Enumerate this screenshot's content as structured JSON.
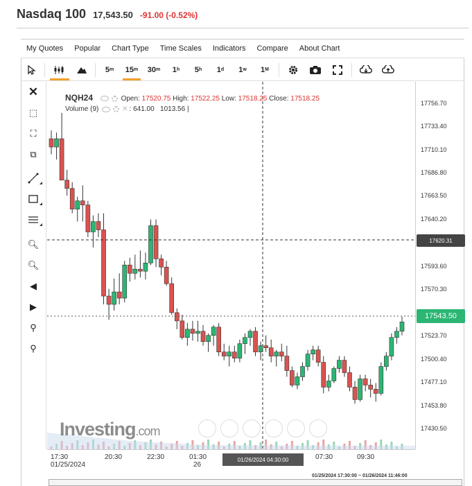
{
  "header": {
    "name": "Nasdaq 100",
    "price": "17,543.50",
    "change": "-91.00 (-0.52%)"
  },
  "menu": [
    "My Quotes",
    "Popular",
    "Chart Type",
    "Time Scales",
    "Indicators",
    "Compare",
    "About Chart"
  ],
  "timeframes": [
    {
      "n": "5",
      "u": "m"
    },
    {
      "n": "15",
      "u": "m"
    },
    {
      "n": "30",
      "u": "m"
    },
    {
      "n": "1",
      "u": "h"
    },
    {
      "n": "5",
      "u": "h"
    },
    {
      "n": "1",
      "u": "d"
    },
    {
      "n": "1",
      "u": "w"
    },
    {
      "n": "1",
      "u": "M"
    }
  ],
  "active_timeframe": "15m",
  "legend": {
    "symbol": "NQH24",
    "open_label": "Open:",
    "open": "17520.75",
    "high_label": "High:",
    "high": "17522.25",
    "low_label": "Low:",
    "low": "17518.25",
    "close_label": "Close:",
    "close": "17518.25",
    "volume_label": "Volume (9)",
    "vol1": "641.00",
    "vol2": "1013.56",
    "vol_suffix": "|"
  },
  "price_ticks": [
    "17756.70",
    "17733.40",
    "17710.10",
    "17686.80",
    "17663.50",
    "17640.20",
    "17593.60",
    "17570.30",
    "17523.70",
    "17500.40",
    "17477.10",
    "17453.80",
    "17430.50"
  ],
  "crosshair_price": "17620.31",
  "last_price": "17543.50",
  "time_ticks": [
    {
      "label": "17:30",
      "sub": "01/25/2024"
    },
    {
      "label": "20:30",
      "sub": ""
    },
    {
      "label": "22:30",
      "sub": ""
    },
    {
      "label": "01:30",
      "sub": "26"
    },
    {
      "label": "07:30",
      "sub": ""
    },
    {
      "label": "09:30",
      "sub": ""
    }
  ],
  "crosshair_time": "01/26/2024 04:30:00",
  "range_label": "01/25/2024 17:30:00 ~ 01/26/2024 11:46:00",
  "watermark": {
    "main": "Investing",
    "suffix": ".com"
  },
  "colors": {
    "up": "#2bb673",
    "down": "#d9534f",
    "accent": "#f0a030"
  },
  "chart_data": {
    "type": "candlestick",
    "symbol": "NQH24",
    "ylim": [
      17420,
      17775
    ],
    "candles": [
      [
        17720,
        17728,
        17705,
        17712
      ],
      [
        17712,
        17726,
        17700,
        17720
      ],
      [
        17720,
        17745,
        17680,
        17680
      ],
      [
        17680,
        17690,
        17665,
        17672
      ],
      [
        17672,
        17678,
        17648,
        17652
      ],
      [
        17652,
        17664,
        17640,
        17660
      ],
      [
        17660,
        17675,
        17640,
        17656
      ],
      [
        17656,
        17660,
        17625,
        17630
      ],
      [
        17630,
        17646,
        17615,
        17640
      ],
      [
        17640,
        17648,
        17625,
        17632
      ],
      [
        17632,
        17648,
        17560,
        17568
      ],
      [
        17568,
        17575,
        17545,
        17560
      ],
      [
        17560,
        17585,
        17554,
        17572
      ],
      [
        17572,
        17590,
        17560,
        17566
      ],
      [
        17566,
        17602,
        17562,
        17598
      ],
      [
        17598,
        17605,
        17582,
        17590
      ],
      [
        17590,
        17608,
        17584,
        17594
      ],
      [
        17594,
        17612,
        17586,
        17592
      ],
      [
        17592,
        17610,
        17584,
        17600
      ],
      [
        17600,
        17642,
        17598,
        17636
      ],
      [
        17636,
        17642,
        17596,
        17604
      ],
      [
        17604,
        17608,
        17588,
        17596
      ],
      [
        17596,
        17602,
        17578,
        17580
      ],
      [
        17580,
        17586,
        17550,
        17552
      ],
      [
        17552,
        17556,
        17536,
        17544
      ],
      [
        17544,
        17550,
        17526,
        17528
      ],
      [
        17528,
        17542,
        17520,
        17536
      ],
      [
        17536,
        17544,
        17525,
        17532
      ],
      [
        17532,
        17544,
        17524,
        17534
      ],
      [
        17534,
        17540,
        17520,
        17524
      ],
      [
        17524,
        17532,
        17514,
        17530
      ],
      [
        17530,
        17540,
        17520,
        17538
      ],
      [
        17538,
        17542,
        17510,
        17514
      ],
      [
        17514,
        17522,
        17506,
        17510
      ],
      [
        17510,
        17520,
        17500,
        17514
      ],
      [
        17514,
        17520,
        17504,
        17508
      ],
      [
        17508,
        17526,
        17504,
        17522
      ],
      [
        17522,
        17532,
        17512,
        17528
      ],
      [
        17528,
        17536,
        17520,
        17534
      ],
      [
        17534,
        17538,
        17510,
        17514
      ],
      [
        17514,
        17524,
        17506,
        17520
      ],
      [
        17520,
        17530,
        17514,
        17518
      ],
      [
        17518,
        17526,
        17504,
        17510
      ],
      [
        17510,
        17516,
        17500,
        17514
      ],
      [
        17514,
        17522,
        17505,
        17510
      ],
      [
        17510,
        17520,
        17490,
        17496
      ],
      [
        17496,
        17500,
        17480,
        17482
      ],
      [
        17482,
        17494,
        17478,
        17490
      ],
      [
        17490,
        17504,
        17486,
        17500
      ],
      [
        17500,
        17516,
        17496,
        17512
      ],
      [
        17512,
        17520,
        17506,
        17516
      ],
      [
        17516,
        17520,
        17500,
        17504
      ],
      [
        17504,
        17510,
        17474,
        17480
      ],
      [
        17480,
        17492,
        17476,
        17486
      ],
      [
        17486,
        17500,
        17484,
        17498
      ],
      [
        17498,
        17510,
        17494,
        17506
      ],
      [
        17506,
        17510,
        17490,
        17494
      ],
      [
        17494,
        17500,
        17476,
        17480
      ],
      [
        17480,
        17486,
        17464,
        17468
      ],
      [
        17468,
        17492,
        17466,
        17488
      ],
      [
        17488,
        17492,
        17476,
        17482
      ],
      [
        17482,
        17488,
        17470,
        17478
      ],
      [
        17478,
        17484,
        17466,
        17474
      ],
      [
        17474,
        17504,
        17472,
        17500
      ],
      [
        17500,
        17514,
        17496,
        17510
      ],
      [
        17510,
        17532,
        17506,
        17528
      ],
      [
        17528,
        17538,
        17522,
        17534
      ],
      [
        17534,
        17548,
        17530,
        17543
      ]
    ]
  }
}
